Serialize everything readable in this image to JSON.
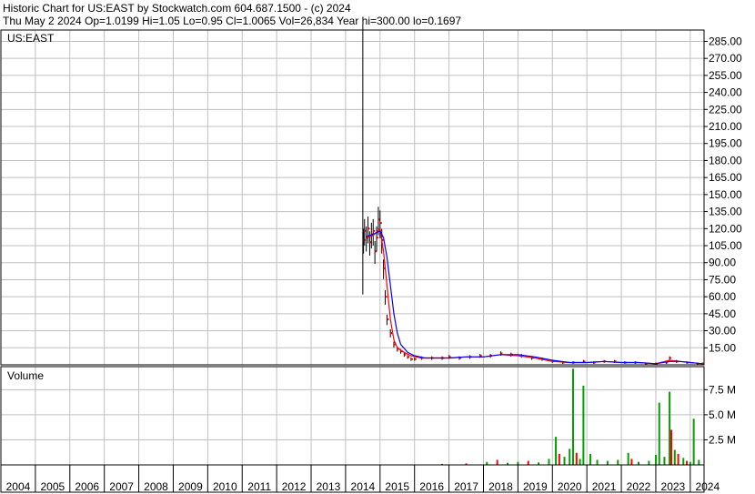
{
  "header": {
    "line1": "Historic Chart for US:EAST by Stockwatch.com 604.687.1500 - (c) 2024",
    "line2": "Thu May  2 2024   Op=1.0199   Hi=1.05   Lo=0.95   Cl=1.0065   Vol=26,834   Year hi=300.00   lo=0.1697"
  },
  "colors": {
    "grid": "#c0c0c0",
    "frame": "#000000",
    "price_bar": "#000000",
    "close_tick": "#ff0000",
    "ma_short": "#ff0000",
    "ma_long": "#0000ff",
    "volume_up": "#00a000",
    "volume_down": "#ff0000"
  },
  "chart_data": [
    {
      "type": "line",
      "panel": "price",
      "label": "US:EAST",
      "x_ticks": [
        "2004",
        "2005",
        "2006",
        "2007",
        "2008",
        "2009",
        "2010",
        "2011",
        "2012",
        "2013",
        "2014",
        "2015",
        "2016",
        "2017",
        "2018",
        "2019",
        "2020",
        "2021",
        "2022",
        "2023",
        "2024"
      ],
      "y_ticks": [
        "15.00",
        "30.00",
        "45.00",
        "60.00",
        "75.00",
        "90.00",
        "105.00",
        "120.00",
        "135.00",
        "150.00",
        "165.00",
        "180.00",
        "195.00",
        "210.00",
        "225.00",
        "240.00",
        "255.00",
        "270.00",
        "285.00"
      ],
      "ylim": [
        0,
        295
      ],
      "xlim": [
        2004.0,
        2024.4
      ],
      "spike": {
        "x": 2014.5,
        "high": 300,
        "low": 62
      },
      "series": [
        {
          "role": "price",
          "x": [
            2014.52,
            2014.55,
            2014.6,
            2014.65,
            2014.7,
            2014.75,
            2014.8,
            2014.85,
            2014.9,
            2014.95,
            2015.0,
            2015.05,
            2015.1,
            2015.15,
            2015.2,
            2015.3,
            2015.4,
            2015.5,
            2015.6,
            2015.7,
            2015.8,
            2015.9,
            2016.0,
            2016.2,
            2016.5,
            2016.8,
            2017.0,
            2017.3,
            2017.6,
            2017.9,
            2018.2,
            2018.5,
            2018.8,
            2019.1,
            2019.4,
            2019.7,
            2020.0,
            2020.3,
            2020.6,
            2020.9,
            2021.2,
            2021.5,
            2021.8,
            2022.1,
            2022.4,
            2022.7,
            2023.0,
            2023.3,
            2023.4,
            2023.6,
            2023.9,
            2024.2,
            2024.35
          ],
          "y": [
            110,
            118,
            112,
            120,
            108,
            115,
            118,
            100,
            112,
            128,
            125,
            110,
            85,
            60,
            40,
            28,
            18,
            14,
            12,
            9,
            7,
            5,
            5,
            6,
            6,
            6,
            7,
            6,
            7,
            8,
            8,
            10,
            9,
            8,
            6,
            5,
            3,
            2,
            2,
            3,
            2,
            3,
            3,
            2,
            2,
            1,
            1,
            2,
            6,
            3,
            2,
            1,
            1
          ]
        },
        {
          "role": "moving-average-short",
          "x": [
            2014.6,
            2014.8,
            2015.0,
            2015.1,
            2015.2,
            2015.3,
            2015.4,
            2015.5,
            2015.7,
            2015.9,
            2016.2,
            2016.6,
            2017.0,
            2017.5,
            2018.0,
            2018.5,
            2019.0,
            2019.5,
            2020.0,
            2020.5,
            2021.0,
            2021.5,
            2022.0,
            2022.5,
            2023.0,
            2023.4,
            2023.7,
            2024.0,
            2024.35
          ],
          "y": [
            112,
            114,
            120,
            100,
            70,
            40,
            22,
            15,
            11,
            8,
            6,
            6,
            6,
            7,
            7,
            9,
            8,
            6,
            3,
            2,
            2,
            3,
            2,
            2,
            1,
            4,
            3,
            2,
            1
          ]
        },
        {
          "role": "moving-average-long",
          "x": [
            2014.6,
            2014.8,
            2015.0,
            2015.1,
            2015.2,
            2015.3,
            2015.4,
            2015.5,
            2015.6,
            2015.8,
            2016.0,
            2016.3,
            2016.6,
            2017.0,
            2017.5,
            2018.0,
            2018.5,
            2019.0,
            2019.5,
            2020.0,
            2020.5,
            2021.0,
            2021.5,
            2022.0,
            2022.5,
            2023.0,
            2023.4,
            2023.7,
            2024.0,
            2024.35
          ],
          "y": [
            113,
            115,
            118,
            112,
            95,
            70,
            45,
            28,
            18,
            11,
            8,
            6,
            6,
            6,
            7,
            7,
            9,
            9,
            7,
            4,
            2,
            2,
            3,
            2,
            2,
            1,
            3,
            3,
            2,
            1
          ]
        }
      ]
    },
    {
      "type": "bar",
      "panel": "volume",
      "label": "Volume",
      "y_ticks": [
        "2.5 M",
        "5.0 M",
        "7.5 M"
      ],
      "ylim": [
        0,
        9.8
      ],
      "xlim": [
        2004.0,
        2024.4
      ],
      "bars": [
        {
          "x": 2016.8,
          "v": 0.1,
          "dir": "up"
        },
        {
          "x": 2017.5,
          "v": 0.15,
          "dir": "down"
        },
        {
          "x": 2018.1,
          "v": 0.3,
          "dir": "up"
        },
        {
          "x": 2018.4,
          "v": 0.5,
          "dir": "down"
        },
        {
          "x": 2018.7,
          "v": 0.2,
          "dir": "up"
        },
        {
          "x": 2019.0,
          "v": 0.3,
          "dir": "up"
        },
        {
          "x": 2019.3,
          "v": 0.4,
          "dir": "down"
        },
        {
          "x": 2019.6,
          "v": 0.25,
          "dir": "up"
        },
        {
          "x": 2019.9,
          "v": 0.6,
          "dir": "up"
        },
        {
          "x": 2020.1,
          "v": 2.8,
          "dir": "up"
        },
        {
          "x": 2020.2,
          "v": 1.1,
          "dir": "down"
        },
        {
          "x": 2020.35,
          "v": 0.8,
          "dir": "up"
        },
        {
          "x": 2020.5,
          "v": 1.6,
          "dir": "up"
        },
        {
          "x": 2020.6,
          "v": 9.6,
          "dir": "up"
        },
        {
          "x": 2020.7,
          "v": 1.2,
          "dir": "down"
        },
        {
          "x": 2020.8,
          "v": 0.6,
          "dir": "up"
        },
        {
          "x": 2020.9,
          "v": 7.9,
          "dir": "up"
        },
        {
          "x": 2021.1,
          "v": 1.1,
          "dir": "up"
        },
        {
          "x": 2021.3,
          "v": 0.5,
          "dir": "up"
        },
        {
          "x": 2021.6,
          "v": 0.4,
          "dir": "up"
        },
        {
          "x": 2021.9,
          "v": 0.5,
          "dir": "up"
        },
        {
          "x": 2022.2,
          "v": 1.2,
          "dir": "up"
        },
        {
          "x": 2022.3,
          "v": 0.6,
          "dir": "down"
        },
        {
          "x": 2022.5,
          "v": 0.3,
          "dir": "up"
        },
        {
          "x": 2022.8,
          "v": 0.4,
          "dir": "up"
        },
        {
          "x": 2023.0,
          "v": 1.0,
          "dir": "up"
        },
        {
          "x": 2023.1,
          "v": 6.2,
          "dir": "up"
        },
        {
          "x": 2023.25,
          "v": 0.8,
          "dir": "up"
        },
        {
          "x": 2023.4,
          "v": 7.3,
          "dir": "up"
        },
        {
          "x": 2023.45,
          "v": 3.5,
          "dir": "down"
        },
        {
          "x": 2023.55,
          "v": 1.5,
          "dir": "up"
        },
        {
          "x": 2023.65,
          "v": 1.1,
          "dir": "down"
        },
        {
          "x": 2023.8,
          "v": 0.7,
          "dir": "up"
        },
        {
          "x": 2023.9,
          "v": 0.4,
          "dir": "down"
        },
        {
          "x": 2024.0,
          "v": 0.3,
          "dir": "up"
        },
        {
          "x": 2024.1,
          "v": 4.6,
          "dir": "up"
        },
        {
          "x": 2024.25,
          "v": 0.5,
          "dir": "up"
        }
      ]
    }
  ]
}
